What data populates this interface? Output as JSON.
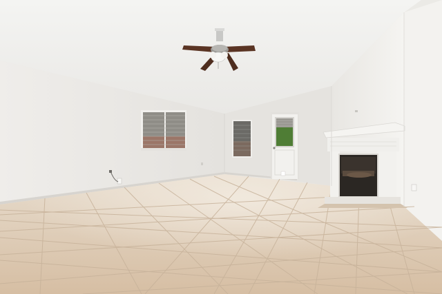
{
  "scene": {
    "description_colors": {
      "ceiling": "#f1f1ef",
      "wall_left": "#eceae7",
      "wall_back": "#e7e5e1",
      "wall_right": "#f0efec",
      "floor": "#dcc8b2",
      "grout": "#c9b39c",
      "fireplace_trim": "#f3f2ef",
      "firebox": "#2a2622",
      "fan_blade": "#5a3423",
      "window_blind": "#8e8d88",
      "foliage": "#4e7a33"
    },
    "objects": [
      {
        "name": "ceiling-fan"
      },
      {
        "name": "window-left"
      },
      {
        "name": "window-back"
      },
      {
        "name": "back-door"
      },
      {
        "name": "fireplace"
      },
      {
        "name": "tile-floor"
      }
    ]
  }
}
